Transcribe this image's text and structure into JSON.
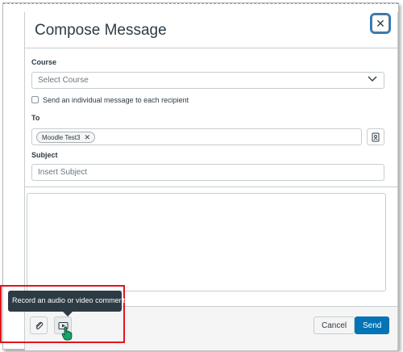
{
  "dialog": {
    "title": "Compose Message",
    "close_icon": "close-icon"
  },
  "form": {
    "course_label": "Course",
    "course_placeholder": "Select Course",
    "individual_message_label": "Send an individual message to each recipient",
    "to_label": "To",
    "recipients": [
      "Moodle Test3"
    ],
    "subject_label": "Subject",
    "subject_placeholder": "Insert Subject",
    "message_body": ""
  },
  "footer": {
    "attach_icon": "paperclip-icon",
    "media_icon": "video-comment-icon",
    "tooltip": "Record an audio or video comment",
    "cancel_label": "Cancel",
    "send_label": "Send"
  },
  "colors": {
    "primary": "#0374b5",
    "tooltip_bg": "#2d3b45",
    "highlight": "#e3141c",
    "text": "#2d3b45"
  }
}
